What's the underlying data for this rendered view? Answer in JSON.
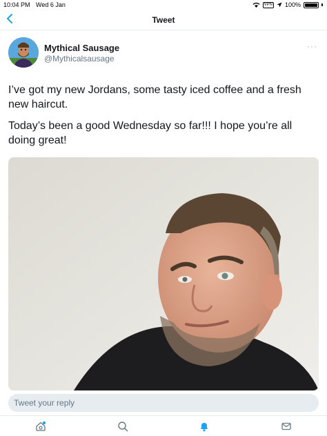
{
  "status_bar": {
    "time": "10:04 PM",
    "date": "Wed 6 Jan",
    "battery": "100%"
  },
  "nav": {
    "title": "Tweet",
    "back_icon": "chevron-left-icon"
  },
  "tweet": {
    "author_name": "Mythical Sausage",
    "author_handle": "@Mythicalsausage",
    "more_label": "···",
    "paragraphs": [
      "I’ve got my new Jordans, some tasty iced coffee and a fresh new haircut.",
      "Today’s been a good Wednesday so far!!! I hope you’re all doing great!"
    ]
  },
  "reply": {
    "placeholder": "Tweet your reply"
  },
  "tabs": [
    {
      "name": "home",
      "icon": "home-icon"
    },
    {
      "name": "search",
      "icon": "search-icon"
    },
    {
      "name": "notifications",
      "icon": "bell-icon"
    },
    {
      "name": "messages",
      "icon": "mail-icon"
    }
  ],
  "colors": {
    "accent": "#1da1f2",
    "text": "#14171a",
    "secondary": "#657786",
    "divider": "#e6ecf0"
  }
}
